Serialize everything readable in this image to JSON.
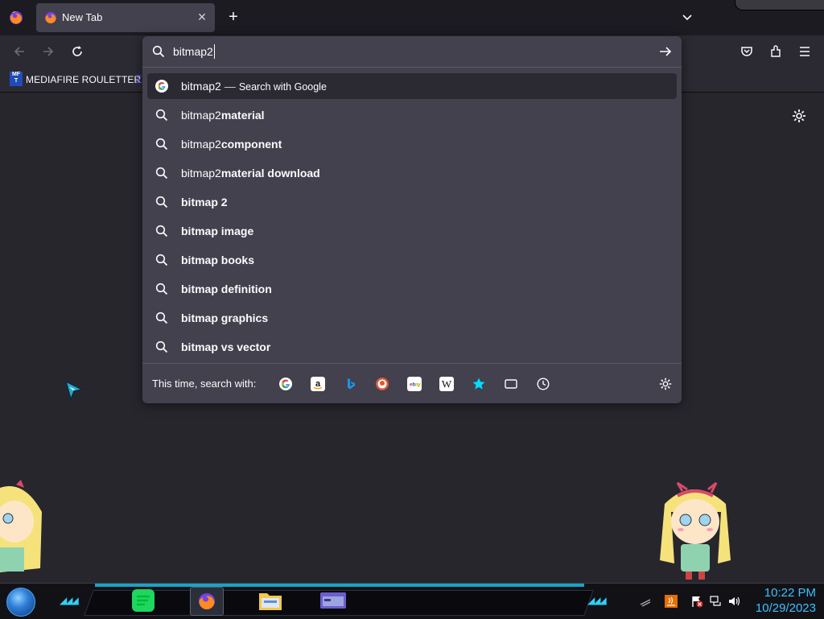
{
  "tabs": [
    {
      "title": "New Tab"
    }
  ],
  "bookmarks": [
    {
      "icon_text": "MF\nT",
      "label": "MEDIAFIRE ROULETTER"
    }
  ],
  "urlbar": {
    "value": "bitmap2",
    "heuristic": {
      "query": "bitmap2",
      "action": "Search with Google"
    },
    "suggestions": [
      {
        "prefix": "bitmap2",
        "bold": "material"
      },
      {
        "prefix": "bitmap2",
        "bold": "component"
      },
      {
        "prefix": "bitmap2",
        "bold": "material download"
      },
      {
        "prefix": "",
        "bold": "bitmap 2"
      },
      {
        "prefix": "",
        "bold": "bitmap image"
      },
      {
        "prefix": "",
        "bold": "bitmap books"
      },
      {
        "prefix": "",
        "bold": "bitmap definition"
      },
      {
        "prefix": "",
        "bold": "bitmap graphics"
      },
      {
        "prefix": "",
        "bold": "bitmap vs vector"
      }
    ],
    "oneoff_label": "This time, search with:",
    "engines": [
      "google-icon",
      "amazon-icon",
      "bing-icon",
      "duckduckgo-icon",
      "ebay-icon",
      "wikipedia-icon",
      "bookmarks-star-icon",
      "tabs-icon",
      "history-clock-icon"
    ]
  },
  "clock": {
    "time": "10:22 PM",
    "date": "10/29/2023"
  },
  "colors": {
    "panel": "#42414d",
    "selected_row": "#2b2a33",
    "accent": "#3ec0ff"
  }
}
